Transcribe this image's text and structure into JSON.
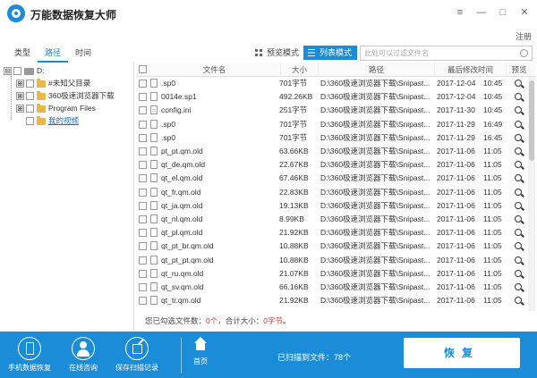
{
  "app": {
    "title": "万能数据恢复大师",
    "register": "注册"
  },
  "window_controls": {
    "menu": "≡",
    "minimize": "—",
    "maximize": "□",
    "close": "✕"
  },
  "tabs": [
    {
      "label": "类型",
      "active": false
    },
    {
      "label": "路径",
      "active": true
    },
    {
      "label": "时间",
      "active": false
    }
  ],
  "view_modes": {
    "preview": "预览模式",
    "list": "列表模式"
  },
  "search": {
    "placeholder": "此处可以过滤文件名"
  },
  "tree": [
    {
      "label": "D:",
      "type": "drive",
      "expander": "⊟"
    },
    {
      "label": "#未知父目录",
      "type": "folder",
      "expander": "⊞"
    },
    {
      "label": "360极速浏览器下载",
      "type": "folder",
      "expander": "⊞"
    },
    {
      "label": "Program Files",
      "type": "folder",
      "expander": "⊞"
    },
    {
      "label": "我的视频",
      "type": "folder",
      "expander": "",
      "link": true
    }
  ],
  "table": {
    "columns": [
      "文件名",
      "大小",
      "路径",
      "最后修改时间",
      "预览"
    ],
    "rows": [
      {
        "name": ".sp0",
        "size": "701字节",
        "path": "D:\\360极速浏览器下载\\Snipast...",
        "date": "2017-12-04",
        "time": "10:45"
      },
      {
        "name": "0014e.sp1",
        "size": "492.26KB",
        "path": "D:\\360极速浏览器下载\\Snipast...",
        "date": "2017-12-04",
        "time": "10:45"
      },
      {
        "name": "config.ini",
        "size": "251字节",
        "path": "D:\\360极速浏览器下载\\Snipast...",
        "date": "2017-11-30",
        "time": "10:45"
      },
      {
        "name": ".sp0",
        "size": "701字节",
        "path": "D:\\360极速浏览器下载\\Snipast...",
        "date": "2017-11-29",
        "time": "16:49"
      },
      {
        "name": ".sp0",
        "size": "701字节",
        "path": "D:\\360极速浏览器下载\\Snipast...",
        "date": "2017-11-29",
        "time": "16:45"
      },
      {
        "name": "pt_pt.qm.old",
        "size": "63.66KB",
        "path": "D:\\360极速浏览器下载\\Snipast...",
        "date": "2017-11-06",
        "time": "11:05"
      },
      {
        "name": "qt_de.qm.old",
        "size": "22.67KB",
        "path": "D:\\360极速浏览器下载\\Snipast...",
        "date": "2017-11-06",
        "time": "11:05"
      },
      {
        "name": "qt_el.qm.old",
        "size": "67.46KB",
        "path": "D:\\360极速浏览器下载\\Snipast...",
        "date": "2017-11-06",
        "time": "11:05"
      },
      {
        "name": "qt_fr.qm.old",
        "size": "22.83KB",
        "path": "D:\\360极速浏览器下载\\Snipast...",
        "date": "2017-11-06",
        "time": "11:05"
      },
      {
        "name": "qt_ja.qm.old",
        "size": "19.13KB",
        "path": "D:\\360极速浏览器下载\\Snipast...",
        "date": "2017-11-06",
        "time": "11:05"
      },
      {
        "name": "qt_nl.qm.old",
        "size": "8.99KB",
        "path": "D:\\360极速浏览器下载\\Snipast...",
        "date": "2017-11-06",
        "time": "11:05"
      },
      {
        "name": "qt_pl.qm.old",
        "size": "21.92KB",
        "path": "D:\\360极速浏览器下载\\Snipast...",
        "date": "2017-11-06",
        "time": "11:05"
      },
      {
        "name": "qt_pt_br.qm.old",
        "size": "10.88KB",
        "path": "D:\\360极速浏览器下载\\Snipast...",
        "date": "2017-11-06",
        "time": "11:05"
      },
      {
        "name": "qt_pt_pt.qm.old",
        "size": "10.88KB",
        "path": "D:\\360极速浏览器下载\\Snipast...",
        "date": "2017-11-06",
        "time": "11:05"
      },
      {
        "name": "qt_ru.qm.old",
        "size": "21.07KB",
        "path": "D:\\360极速浏览器下载\\Snipast...",
        "date": "2017-11-06",
        "time": "11:05"
      },
      {
        "name": "qt_sv.qm.old",
        "size": "66.16KB",
        "path": "D:\\360极速浏览器下载\\Snipast...",
        "date": "2017-11-06",
        "time": "11:05"
      },
      {
        "name": "qt_tr.qm.old",
        "size": "21.92KB",
        "path": "D:\\360极速浏览器下载\\Snipast...",
        "date": "2017-11-06",
        "time": "11:05"
      }
    ]
  },
  "status": {
    "prefix": "您已勾选文件数：",
    "count": "0个",
    "middle": "，合计大小：",
    "size": "0字节",
    "suffix": "。"
  },
  "bottom": {
    "phone_recovery": "手机数据恢复",
    "online_consult": "在线咨询",
    "save_scan": "保存扫描记录",
    "home": "首页",
    "scanned": "已扫描到文件：78个",
    "recover": "恢复"
  },
  "colors": {
    "accent": "#1a8cd8",
    "highlight": "#e03030"
  }
}
